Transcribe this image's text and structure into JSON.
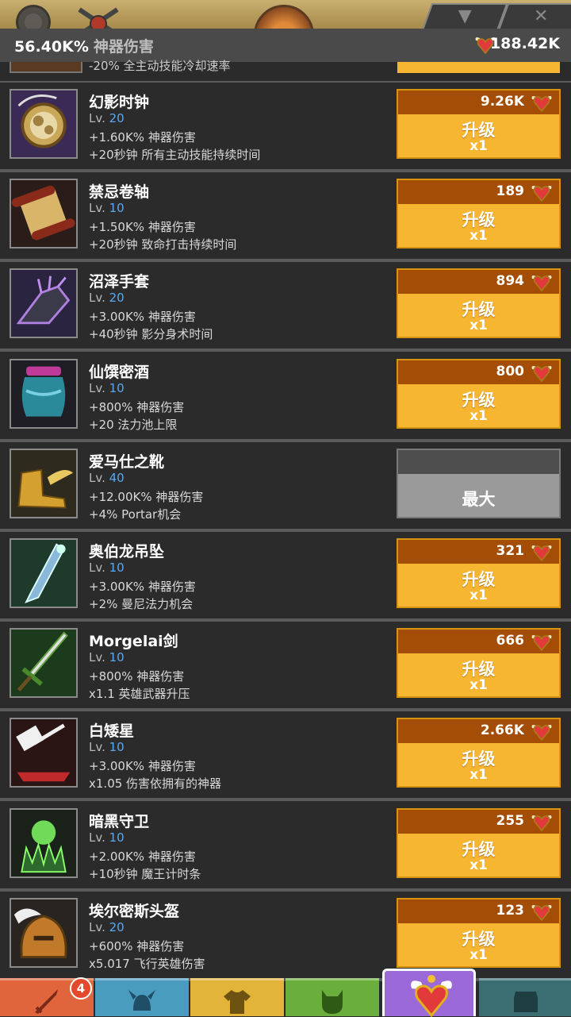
{
  "header": {
    "artifact_damage_value": "56.40K%",
    "artifact_damage_label": "神器伤害",
    "currency_amount": "188.42K"
  },
  "top_tabs": {
    "collapse_icon": "chevron-down-icon",
    "close_icon": "close-icon"
  },
  "partial_row": {
    "effect": "-20% 全主动技能冷却速率"
  },
  "artifacts": [
    {
      "name": "幻影时钟",
      "lv_label": "Lv.",
      "level": "20",
      "effect1": "+1.60K% 神器伤害",
      "effect2": "+20秒钟 所有主动技能持续时间",
      "cost": "9.26K",
      "button": "升级",
      "multiplier": "x1",
      "icon": "clock-icon",
      "maxed": false
    },
    {
      "name": "禁忌卷轴",
      "lv_label": "Lv.",
      "level": "10",
      "effect1": "+1.50K% 神器伤害",
      "effect2": "+20秒钟 致命打击持续时间",
      "cost": "189",
      "button": "升级",
      "multiplier": "x1",
      "icon": "scroll-icon",
      "maxed": false
    },
    {
      "name": "沼泽手套",
      "lv_label": "Lv.",
      "level": "20",
      "effect1": "+3.00K% 神器伤害",
      "effect2": "+40秒钟 影分身术时间",
      "cost": "894",
      "button": "升级",
      "multiplier": "x1",
      "icon": "gauntlet-icon",
      "maxed": false
    },
    {
      "name": "仙馔密酒",
      "lv_label": "Lv.",
      "level": "10",
      "effect1": "+800% 神器伤害",
      "effect2": "+20 法力池上限",
      "cost": "800",
      "button": "升级",
      "multiplier": "x1",
      "icon": "jar-icon",
      "maxed": false
    },
    {
      "name": "爱马仕之靴",
      "lv_label": "Lv.",
      "level": "40",
      "effect1": "+12.00K% 神器伤害",
      "effect2": "+4% Portar机会",
      "cost": "",
      "button": "最大",
      "multiplier": "",
      "icon": "winged-boots-icon",
      "maxed": true
    },
    {
      "name": "奥伯龙吊坠",
      "lv_label": "Lv.",
      "level": "10",
      "effect1": "+3.00K% 神器伤害",
      "effect2": "+2% 曼尼法力机会",
      "cost": "321",
      "button": "升级",
      "multiplier": "x1",
      "icon": "pendant-icon",
      "maxed": false
    },
    {
      "name": "Morgelai剑",
      "lv_label": "Lv.",
      "level": "10",
      "effect1": "+800% 神器伤害",
      "effect2": "x1.1 英雄武器升压",
      "cost": "666",
      "button": "升级",
      "multiplier": "x1",
      "icon": "sword-icon",
      "maxed": false
    },
    {
      "name": "白矮星",
      "lv_label": "Lv.",
      "level": "10",
      "effect1": "+3.00K% 神器伤害",
      "effect2": "x1.05 伤害依拥有的神器",
      "cost": "2.66K",
      "button": "升级",
      "multiplier": "x1",
      "icon": "hammer-icon",
      "maxed": false
    },
    {
      "name": "暗黑守卫",
      "lv_label": "Lv.",
      "level": "10",
      "effect1": "+2.00K% 神器伤害",
      "effect2": "+10秒钟 魔王计时条",
      "cost": "255",
      "button": "升级",
      "multiplier": "x1",
      "icon": "guardian-icon",
      "maxed": false
    },
    {
      "name": "埃尔密斯头盔",
      "lv_label": "Lv.",
      "level": "20",
      "effect1": "+600% 神器伤害",
      "effect2": "x5.017 飞行英雄伤害",
      "cost": "123",
      "button": "升级",
      "multiplier": "x1",
      "icon": "helmet-icon",
      "maxed": false
    }
  ],
  "bottom_nav": {
    "tabs": [
      {
        "name": "sword-tab",
        "icon": "sword-icon",
        "color": "#e0643c"
      },
      {
        "name": "heroes-tab",
        "icon": "horned-helmet-icon",
        "color": "#4a9cbf"
      },
      {
        "name": "equipment-tab",
        "icon": "shirt-icon",
        "color": "#e3b43a"
      },
      {
        "name": "pets-tab",
        "icon": "pet-icon",
        "color": "#6aae3e"
      },
      {
        "name": "artifacts-tab",
        "icon": "winged-heart-icon",
        "color": "#9b6ad8"
      },
      {
        "name": "shop-tab",
        "icon": "chest-icon",
        "color": "#3b6e73"
      }
    ],
    "badge_count": "4"
  }
}
